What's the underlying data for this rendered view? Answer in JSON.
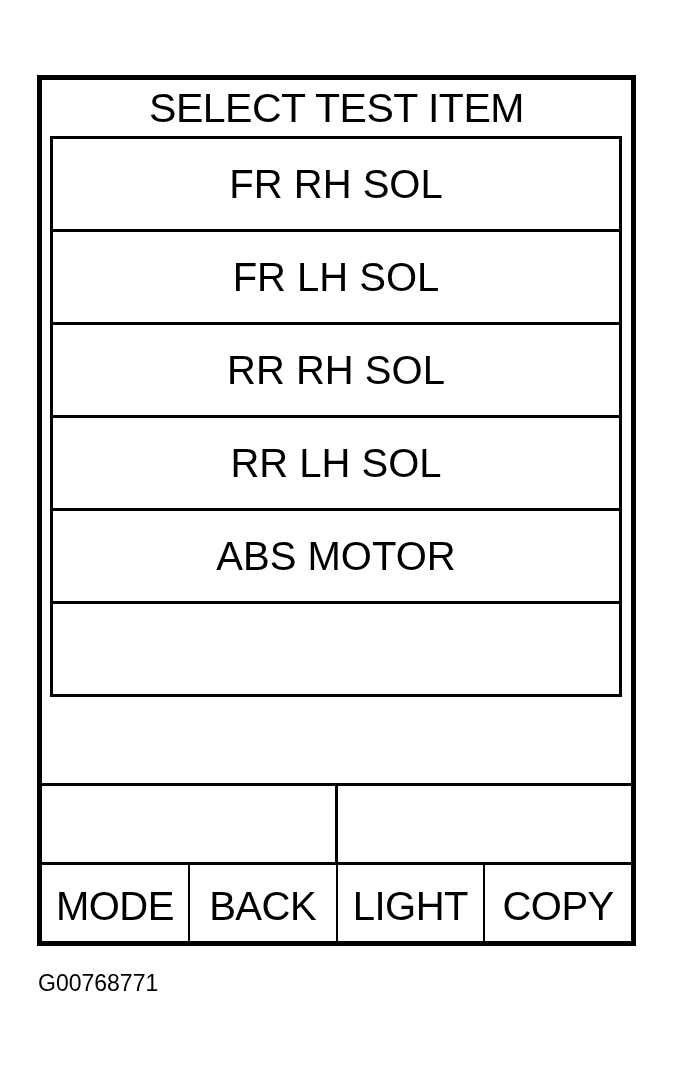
{
  "screen": {
    "title": "SELECT TEST ITEM",
    "items": [
      {
        "label": "FR RH SOL",
        "selected": false
      },
      {
        "label": "FR LH SOL",
        "selected": false
      },
      {
        "label": "RR RH SOL",
        "selected": false
      },
      {
        "label": "RR LH SOL",
        "selected": false
      },
      {
        "label": "ABS MOTOR",
        "selected": false
      }
    ],
    "soft_keys": [
      "MODE",
      "BACK",
      "LIGHT",
      "COPY"
    ]
  },
  "figure_id": "G00768771"
}
